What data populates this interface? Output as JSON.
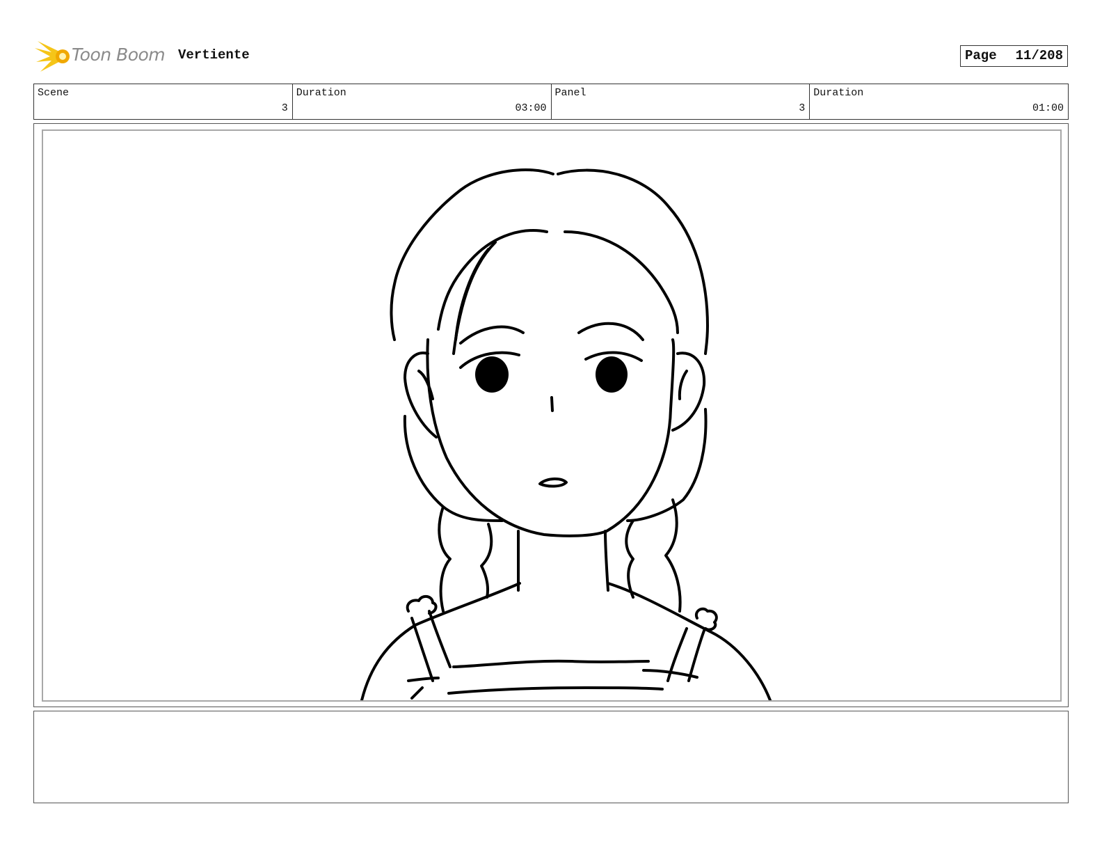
{
  "header": {
    "logo_text": "Toon Boom",
    "project_title": "Vertiente",
    "page_label": "Page",
    "page_value": "11/208"
  },
  "info": [
    {
      "label": "Scene",
      "value": "3"
    },
    {
      "label": "Duration",
      "value": "03:00"
    },
    {
      "label": "Panel",
      "value": "3"
    },
    {
      "label": "Duration",
      "value": "01:00"
    }
  ],
  "colors": {
    "logo_accent": "#f5c518",
    "logo_text": "#8a8a8a",
    "ink": "#000000"
  },
  "icons": {
    "logo": "toon-boom-flame-icon"
  },
  "notes": ""
}
